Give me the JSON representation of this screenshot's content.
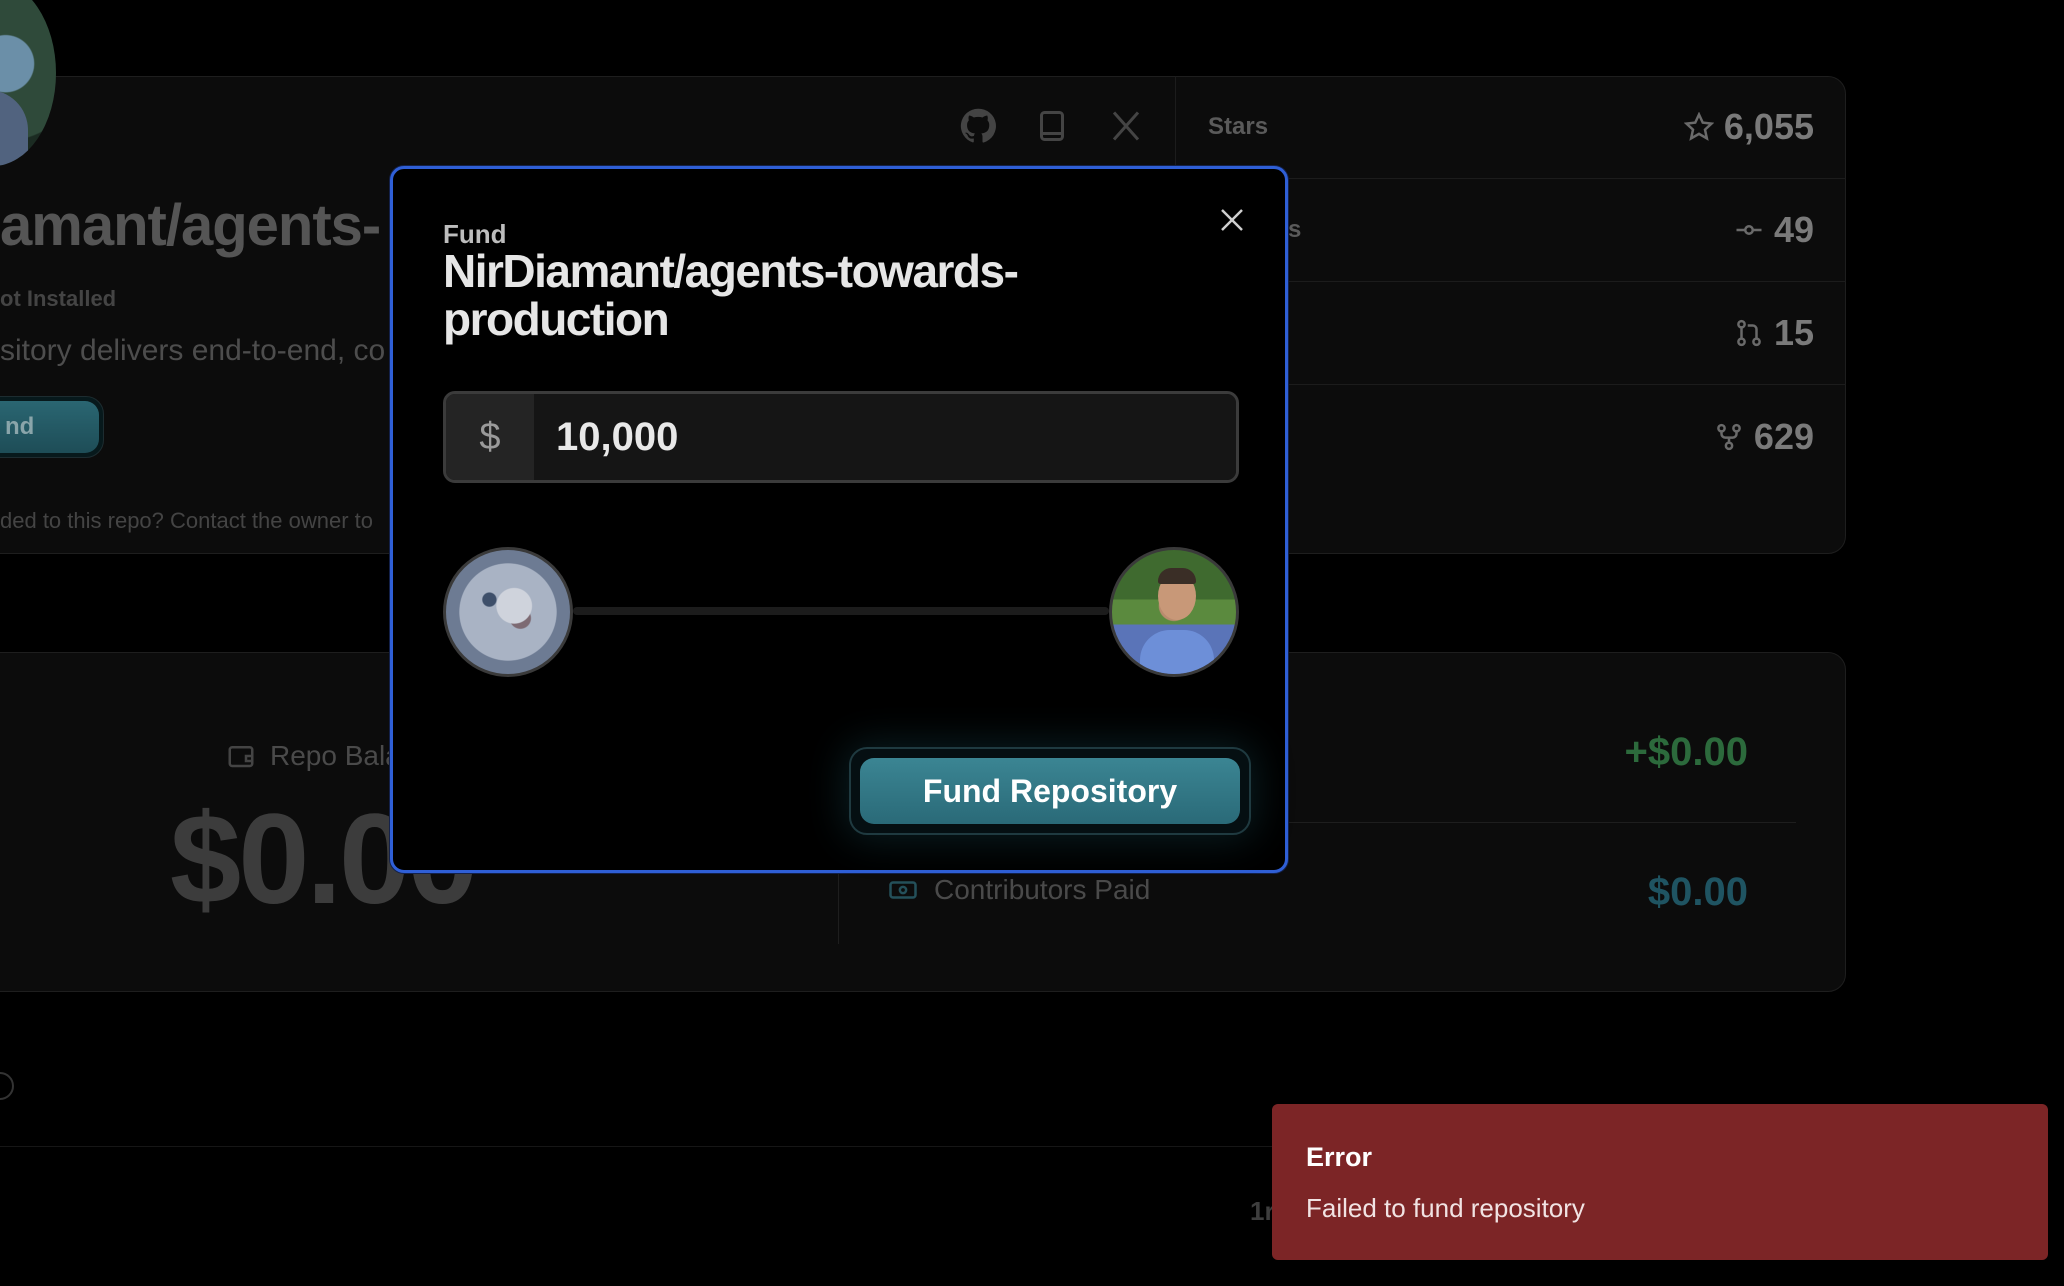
{
  "repo": {
    "title_partial": "amant/agents-",
    "install_status": "ot Installed",
    "description_partial": "sitory delivers end-to-end, co",
    "fund_button_partial": "nd",
    "contact_partial": "ded to this repo? Contact the owner to"
  },
  "stats": [
    {
      "label": "Stars",
      "value": "6,055",
      "icon": "star-icon"
    },
    {
      "label": "ts",
      "value": "49",
      "icon": "commit-icon"
    },
    {
      "label": "",
      "value": "15",
      "icon": "pull-request-icon"
    },
    {
      "label": "",
      "value": "629",
      "icon": "fork-icon"
    }
  ],
  "balance": {
    "label_partial": "Repo Bala",
    "value_partial": "$0.00",
    "incoming": "+$0.00",
    "contributors_label": "Contributors Paid",
    "contributors_value": "$0.00"
  },
  "bottom_partial": "1r",
  "modal": {
    "kicker": "Fund",
    "title": "NirDiamant/agents-towards-production",
    "currency_symbol": "$",
    "amount": "10,000",
    "submit_label": "Fund Repository"
  },
  "toast": {
    "title": "Error",
    "message": "Failed to fund repository",
    "color": "#7c2526"
  },
  "colors": {
    "accent": "#2f5fd6",
    "teal": "#3b8593",
    "positive": "#2c6a3c"
  }
}
